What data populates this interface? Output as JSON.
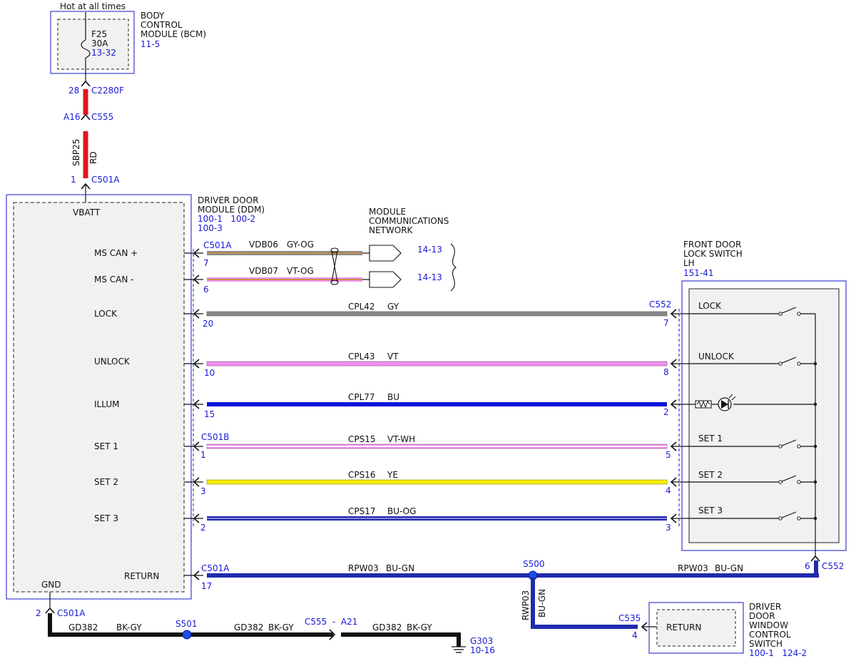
{
  "colors": {
    "outline_blue": "#3c3cd2",
    "label_blue": "#1a1ad6",
    "module_fill": "#f1f1f1",
    "wire_red": "#e3161c",
    "wire_gray": "#888888",
    "wire_violet": "#ee90ee",
    "wire_blue": "#0b16d8",
    "wire_yellow": "#f5ee08",
    "wire_navy": "#1e2cae",
    "wire_black": "#111111",
    "wire_gy_og_orange": "#c79046"
  },
  "top": {
    "hot_label": "Hot at all times",
    "bcm": {
      "title_lines": [
        "BODY",
        "CONTROL",
        "MODULE (BCM)"
      ],
      "ref": "11-5",
      "fuse_name": "F25",
      "fuse_rating": "30A",
      "fuse_ref": "13-32"
    },
    "c2280f": {
      "pin": "28",
      "name": "C2280F"
    },
    "c555": {
      "pin": "A16",
      "name": "C555"
    },
    "wire": {
      "circuit": "SBP25",
      "color": "RD"
    },
    "c501a_top": {
      "pin": "1",
      "name": "C501A"
    }
  },
  "ddm": {
    "title_lines": [
      "DRIVER DOOR",
      "MODULE (DDM)"
    ],
    "refs_line1": "100-1   100-2",
    "refs_line2": "100-3",
    "vbatt": "VBATT",
    "gnd": "GND"
  },
  "mcn": {
    "title_lines": [
      "MODULE",
      "COMMUNICATIONS",
      "NETWORK"
    ]
  },
  "signals": [
    {
      "name": "MS CAN +",
      "connector": "C501A",
      "pin": "7",
      "circuit": "VDB06",
      "wire_color": "GY-OG",
      "ref": "14-13"
    },
    {
      "name": "MS CAN -",
      "pin": "6",
      "circuit": "VDB07",
      "wire_color": "VT-OG",
      "ref": "14-13"
    },
    {
      "name": "LOCK",
      "pin": "20",
      "circuit": "CPL42",
      "wire_color": "GY",
      "far_connector": "C552",
      "far_pin": "7",
      "switch_label": "LOCK"
    },
    {
      "name": "UNLOCK",
      "pin": "10",
      "circuit": "CPL43",
      "wire_color": "VT",
      "far_pin": "8",
      "switch_label": "UNLOCK"
    },
    {
      "name": "ILLUM",
      "pin": "15",
      "circuit": "CPL77",
      "wire_color": "BU",
      "far_pin": "2"
    },
    {
      "name": "SET 1",
      "connector": "C501B",
      "pin": "1",
      "circuit": "CPS15",
      "wire_color": "VT-WH",
      "far_pin": "5",
      "switch_label": "SET 1"
    },
    {
      "name": "SET 2",
      "pin": "3",
      "circuit": "CPS16",
      "wire_color": "YE",
      "far_pin": "4",
      "switch_label": "SET 2"
    },
    {
      "name": "SET 3",
      "pin": "2",
      "circuit": "CPS17",
      "wire_color": "BU-OG",
      "far_pin": "3",
      "switch_label": "SET 3"
    }
  ],
  "return_line": {
    "name": "RETURN",
    "connector": "C501A",
    "pin": "17",
    "circuit_left": "RPW03",
    "color_left": "BU-GN",
    "splice": "S500",
    "circuit_right": "RPW03",
    "color_right": "BU-GN",
    "far_pin": "6",
    "far_connector": "C552",
    "drop_circuit": "RWP03",
    "drop_color": "BU-GN"
  },
  "lock_switch": {
    "title_lines": [
      "FRONT DOOR",
      "LOCK SWITCH",
      "LH"
    ],
    "ref": "151-41"
  },
  "window_switch": {
    "connector": "C535",
    "pin": "4",
    "label": "RETURN",
    "title_lines": [
      "DRIVER",
      "DOOR",
      "WINDOW",
      "CONTROL",
      "SWITCH"
    ],
    "refs": "100-1   124-2"
  },
  "ground": {
    "pin": "2",
    "connector": "C501A",
    "circuit1": "GD382",
    "color1": "BK-GY",
    "splice": "S501",
    "circuit2": "GD382",
    "color2": "BK-GY",
    "inline_connector": "C555  -  A21",
    "circuit3": "GD382",
    "color3": "BK-GY",
    "ground_name": "G303",
    "ground_ref": "10-16"
  }
}
